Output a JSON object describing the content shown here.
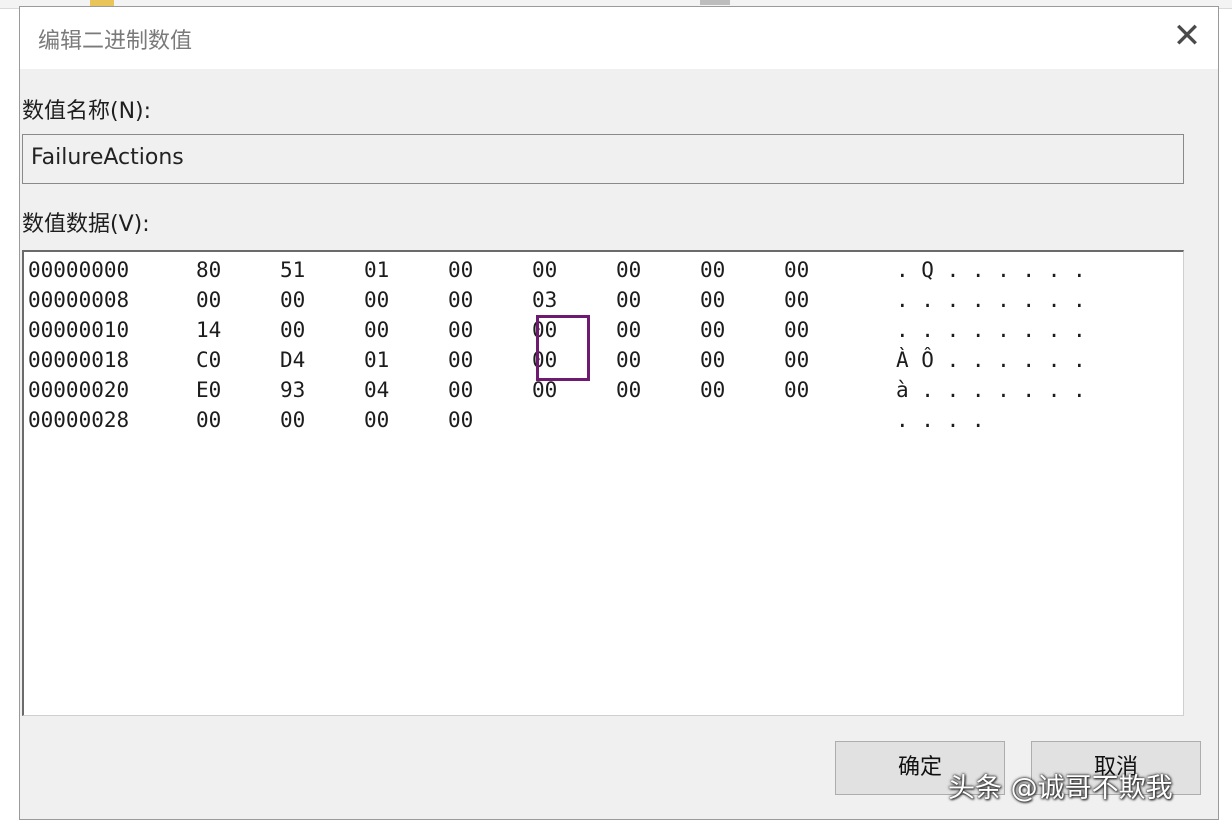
{
  "dialog": {
    "title": "编辑二进制数值",
    "close_glyph": "✕"
  },
  "value_name": {
    "label": "数值名称(N):",
    "value": "FailureActions"
  },
  "value_data": {
    "label": "数值数据(V):",
    "rows": [
      {
        "offset": "00000000",
        "bytes": [
          "80",
          "51",
          "01",
          "00",
          "00",
          "00",
          "00",
          "00"
        ],
        "ascii": ". Q . . . . . ."
      },
      {
        "offset": "00000008",
        "bytes": [
          "00",
          "00",
          "00",
          "00",
          "03",
          "00",
          "00",
          "00"
        ],
        "ascii": ". . . . . . . ."
      },
      {
        "offset": "00000010",
        "bytes": [
          "14",
          "00",
          "00",
          "00",
          "00",
          "00",
          "00",
          "00"
        ],
        "ascii": ". . . . . . . ."
      },
      {
        "offset": "00000018",
        "bytes": [
          "C0",
          "D4",
          "01",
          "00",
          "00",
          "00",
          "00",
          "00"
        ],
        "ascii": "À Ô . . . . . ."
      },
      {
        "offset": "00000020",
        "bytes": [
          "E0",
          "93",
          "04",
          "00",
          "00",
          "00",
          "00",
          "00"
        ],
        "ascii": "à . . . . . . ."
      },
      {
        "offset": "00000028",
        "bytes": [
          "00",
          "00",
          "00",
          "00"
        ],
        "ascii": ". . . ."
      }
    ]
  },
  "buttons": {
    "ok_label": "确定",
    "cancel_label": "取消"
  },
  "watermark": "头条 @诚哥不欺我",
  "colors": {
    "highlight_box": "#6e1a70"
  }
}
